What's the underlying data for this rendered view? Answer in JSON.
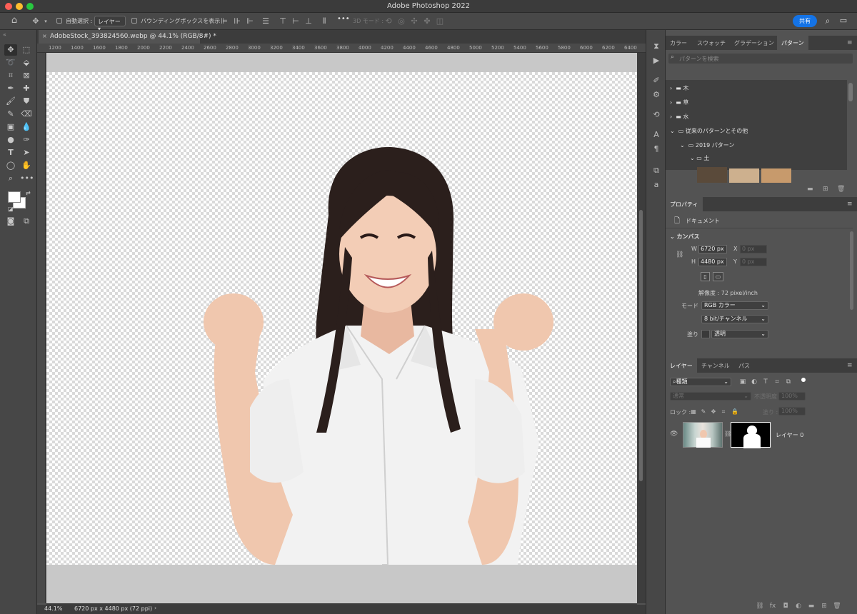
{
  "window": {
    "title": "Adobe Photoshop 2022"
  },
  "options_bar": {
    "auto_select_label": "自動選択 :",
    "auto_select_target": "レイヤー",
    "bounding_box_label": "バウンディングボックスを表示",
    "more": "•••",
    "mode_3d_label": "3D モード :",
    "share_label": "共有"
  },
  "document": {
    "tab_title": "AdobeStock_393824560.webp @ 44.1% (RGB/8#) *",
    "ruler_marks": [
      "1200",
      "1400",
      "1600",
      "1800",
      "2000",
      "2200",
      "2400",
      "2600",
      "2800",
      "3000",
      "3200",
      "3400",
      "3600",
      "3800",
      "4000",
      "4200",
      "4400",
      "4600",
      "4800",
      "5000",
      "5200",
      "5400",
      "5600",
      "5800",
      "6000",
      "6200",
      "6400"
    ],
    "zoom": "44.1%",
    "size_info": "6720 px x 4480 px (72 ppi)"
  },
  "patterns_panel": {
    "tabs": [
      "カラー",
      "スウォッチ",
      "グラデーション",
      "パターン"
    ],
    "active_tab": "パターン",
    "search_placeholder": "パターンを検索",
    "groups": [
      {
        "label": "木",
        "expanded": false
      },
      {
        "label": "草",
        "expanded": false
      },
      {
        "label": "水",
        "expanded": false
      },
      {
        "label": "従来のパターンとその他",
        "expanded": true
      },
      {
        "label": "2019 パターン",
        "expanded": true
      },
      {
        "label": "土",
        "expanded": true
      }
    ],
    "swatch_colors": [
      "#5a4a3a",
      "#cdb08e",
      "#c79a6c"
    ]
  },
  "properties_panel": {
    "title": "プロパティ",
    "doc_label": "ドキュメント",
    "section": "カンバス",
    "w_label": "W",
    "w_value": "6720 px",
    "h_label": "H",
    "h_value": "4480 px",
    "x_label": "X",
    "x_value": "0 px",
    "y_label": "Y",
    "y_value": "0 px",
    "resolution": "解像度 : 72 pixel/inch",
    "mode_label": "モード",
    "mode_value": "RGB カラー",
    "depth_value": "8 bit/チャンネル",
    "fill_label": "塗り",
    "fill_value": "透明"
  },
  "layers_panel": {
    "tabs": [
      "レイヤー",
      "チャンネル",
      "パス"
    ],
    "active_tab": "レイヤー",
    "filter_kind": "種類",
    "blend_mode": "通常",
    "opacity_label": "不透明度 :",
    "opacity_value": "100%",
    "lock_label": "ロック :",
    "fill_label": "塗り :",
    "fill_value": "100%",
    "layers": [
      {
        "name": "レイヤー 0",
        "visible": true
      }
    ]
  },
  "colors": {
    "accent": "#1473e6",
    "panel": "#535353",
    "dark": "#3d3d3d"
  }
}
